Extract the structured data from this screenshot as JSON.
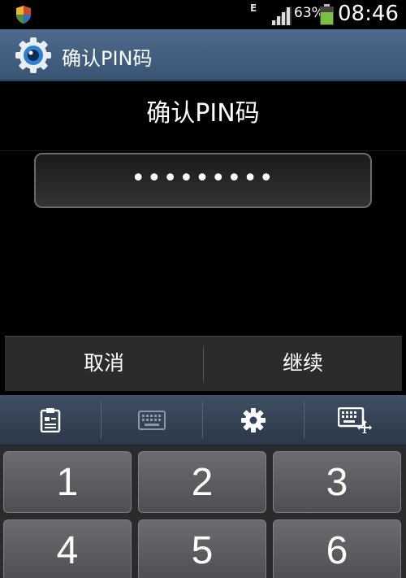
{
  "status_bar": {
    "network_type": "E",
    "battery_percent": "63%",
    "time": "08:46",
    "icons": [
      "shield-icon",
      "signal-icon",
      "battery-icon"
    ]
  },
  "title_bar": {
    "title": "确认PIN码",
    "icon": "gear-eye-icon"
  },
  "prompt": "确认PIN码",
  "pin_field": {
    "value": "•••••••••"
  },
  "buttons": {
    "cancel": "取消",
    "continue": "继续"
  },
  "keyboard": {
    "toolbar": [
      "clipboard-icon",
      "keyboard-icon",
      "settings-gear-icon",
      "keyboard-resize-icon"
    ],
    "keys": [
      "1",
      "2",
      "3",
      "4",
      "5",
      "6"
    ]
  },
  "colors": {
    "title_bar": "#4d6a8c",
    "keyboard_toolbar": "#3f4f63",
    "key": "#5b5d61",
    "battery": "#7ac142"
  }
}
